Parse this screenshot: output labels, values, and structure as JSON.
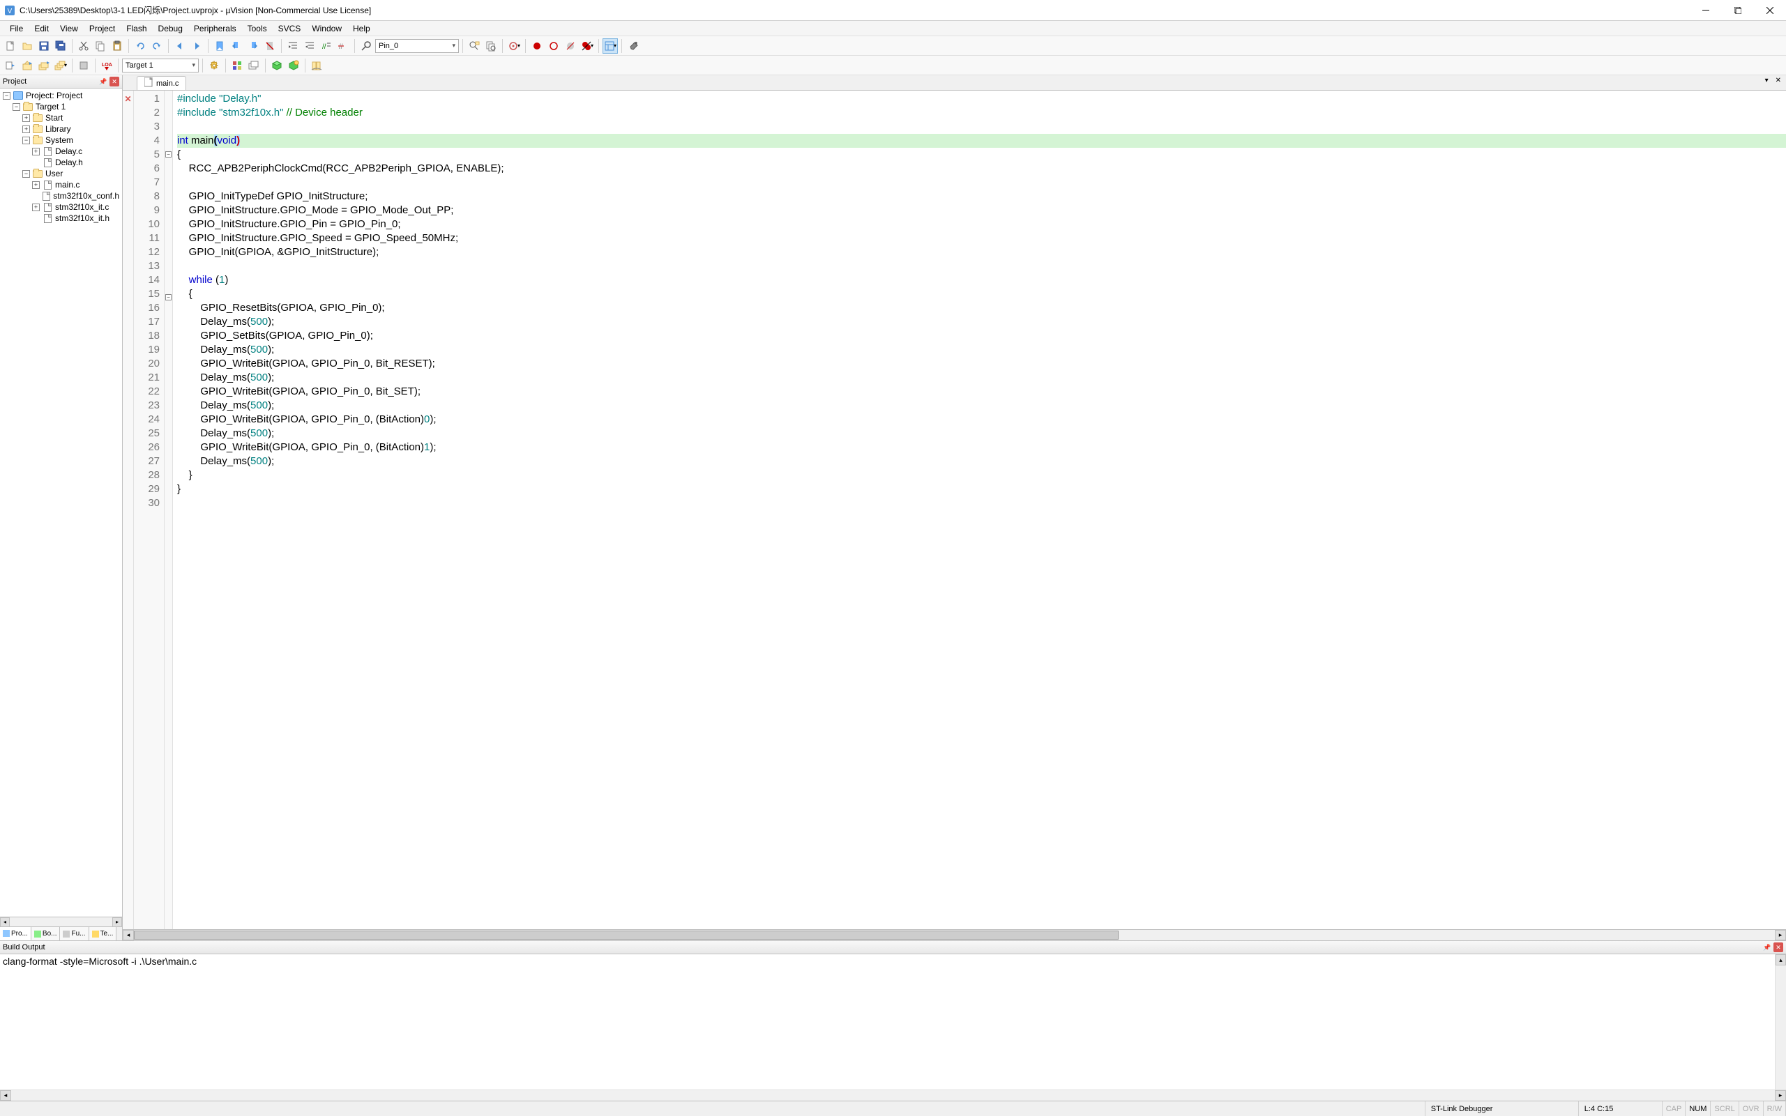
{
  "title": "C:\\Users\\25389\\Desktop\\3-1 LED闪烁\\Project.uvprojx - µVision   [Non-Commercial Use License]",
  "menu": [
    "File",
    "Edit",
    "View",
    "Project",
    "Flash",
    "Debug",
    "Peripherals",
    "Tools",
    "SVCS",
    "Window",
    "Help"
  ],
  "toolbar1": {
    "find_combo": "Pin_0"
  },
  "toolbar2": {
    "target_combo": "Target 1"
  },
  "project_panel": {
    "title": "Project",
    "root": "Project: Project",
    "target": "Target 1",
    "groups": [
      {
        "name": "Start",
        "files": []
      },
      {
        "name": "Library",
        "files": []
      },
      {
        "name": "System",
        "files": [
          "Delay.c",
          "Delay.h"
        ]
      },
      {
        "name": "User",
        "files": [
          "main.c",
          "stm32f10x_conf.h",
          "stm32f10x_it.c",
          "stm32f10x_it.h"
        ]
      }
    ],
    "tabs": [
      "Pro...",
      "Bo...",
      "{} Fu...",
      "0→ Te..."
    ]
  },
  "editor": {
    "tab": "main.c",
    "lines": [
      {
        "n": 1,
        "err": true,
        "html": "<span class='pp'>#include</span> <span class='str'>\"Delay.h\"</span>"
      },
      {
        "n": 2,
        "html": "<span class='pp'>#include</span> <span class='str'>\"stm32f10x.h\"</span> <span class='cmt'>// Device header</span>"
      },
      {
        "n": 3,
        "html": ""
      },
      {
        "n": 4,
        "hl": true,
        "html": "<span class='kw'>int</span> main<span class='paren-hl'>(</span><span class='kw'>void</span><span class='paren-hl2'>)</span>"
      },
      {
        "n": 5,
        "fold": "-",
        "html": "{"
      },
      {
        "n": 6,
        "html": "    RCC_APB2PeriphClockCmd(RCC_APB2Periph_GPIOA, ENABLE);"
      },
      {
        "n": 7,
        "html": ""
      },
      {
        "n": 8,
        "html": "    GPIO_InitTypeDef GPIO_InitStructure;"
      },
      {
        "n": 9,
        "html": "    GPIO_InitStructure.GPIO_Mode = GPIO_Mode_Out_PP;"
      },
      {
        "n": 10,
        "html": "    GPIO_InitStructure.GPIO_Pin = GPIO_Pin_0;"
      },
      {
        "n": 11,
        "html": "    GPIO_InitStructure.GPIO_Speed = GPIO_Speed_50MHz;"
      },
      {
        "n": 12,
        "html": "    GPIO_Init(GPIOA, &GPIO_InitStructure);"
      },
      {
        "n": 13,
        "html": ""
      },
      {
        "n": 14,
        "html": "    <span class='kw'>while</span> (<span class='num'>1</span>)"
      },
      {
        "n": 15,
        "fold": "-",
        "html": "    {"
      },
      {
        "n": 16,
        "html": "        GPIO_ResetBits(GPIOA, GPIO_Pin_0);"
      },
      {
        "n": 17,
        "html": "        Delay_ms(<span class='num'>500</span>);"
      },
      {
        "n": 18,
        "html": "        GPIO_SetBits(GPIOA, GPIO_Pin_0);"
      },
      {
        "n": 19,
        "html": "        Delay_ms(<span class='num'>500</span>);"
      },
      {
        "n": 20,
        "html": "        GPIO_WriteBit(GPIOA, GPIO_Pin_0, Bit_RESET);"
      },
      {
        "n": 21,
        "html": "        Delay_ms(<span class='num'>500</span>);"
      },
      {
        "n": 22,
        "html": "        GPIO_WriteBit(GPIOA, GPIO_Pin_0, Bit_SET);"
      },
      {
        "n": 23,
        "html": "        Delay_ms(<span class='num'>500</span>);"
      },
      {
        "n": 24,
        "html": "        GPIO_WriteBit(GPIOA, GPIO_Pin_0, (BitAction)<span class='num'>0</span>);"
      },
      {
        "n": 25,
        "html": "        Delay_ms(<span class='num'>500</span>);"
      },
      {
        "n": 26,
        "html": "        GPIO_WriteBit(GPIOA, GPIO_Pin_0, (BitAction)<span class='num'>1</span>);"
      },
      {
        "n": 27,
        "html": "        Delay_ms(<span class='num'>500</span>);"
      },
      {
        "n": 28,
        "html": "    }"
      },
      {
        "n": 29,
        "html": "}"
      },
      {
        "n": 30,
        "html": ""
      }
    ]
  },
  "build_output": {
    "title": "Build Output",
    "text": "clang-format -style=Microsoft -i .\\User\\main.c"
  },
  "statusbar": {
    "debugger": "ST-Link Debugger",
    "pos": "L:4 C:15",
    "indicators": [
      "CAP",
      "NUM",
      "SCRL",
      "OVR",
      "R/W"
    ]
  }
}
